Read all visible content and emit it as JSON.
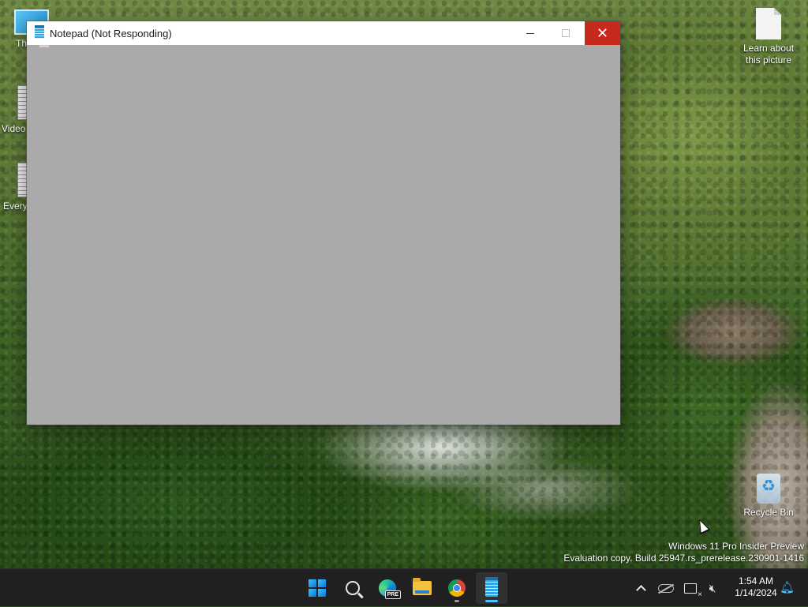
{
  "desktop": {
    "icons": [
      {
        "label": "Th",
        "icon": "this-pc-icon"
      },
      {
        "label": "Video",
        "icon": "document-icon"
      },
      {
        "label": "Every",
        "icon": "document-icon"
      },
      {
        "label": "Learn about this picture",
        "icon": "document-icon"
      },
      {
        "label": "Recycle Bin",
        "icon": "recycle-bin-icon"
      }
    ],
    "watermark": {
      "line1": "Windows 11 Pro Insider Preview",
      "line2": "Evaluation copy. Build 25947.rs_prerelease.230901-1416"
    }
  },
  "window": {
    "title": "Notepad (Not Responding)",
    "app_icon": "notepad-icon",
    "controls": {
      "minimize": "minimize-icon",
      "maximize": "maximize-icon",
      "close": "close-icon"
    },
    "close_color": "#c42b1c",
    "client_color": "#aaaaaa"
  },
  "taskbar": {
    "apps": [
      {
        "name": "Start",
        "icon": "windows-start-icon",
        "running": false
      },
      {
        "name": "Search",
        "icon": "search-icon",
        "running": false
      },
      {
        "name": "Microsoft Edge Preview",
        "icon": "edge-icon",
        "badge": "PRE",
        "running": false
      },
      {
        "name": "File Explorer",
        "icon": "folder-icon",
        "running": false
      },
      {
        "name": "Google Chrome",
        "icon": "chrome-icon",
        "running": true
      },
      {
        "name": "Notepad",
        "icon": "notepad-icon",
        "running": true,
        "active": true
      }
    ],
    "tray": {
      "icons": [
        "show-hidden-icons-chevron",
        "onedrive-icon",
        "network-icon",
        "volume-muted-icon"
      ],
      "time": "1:54 AM",
      "date": "1/14/2024",
      "notification_icon": "bell-icon"
    }
  }
}
